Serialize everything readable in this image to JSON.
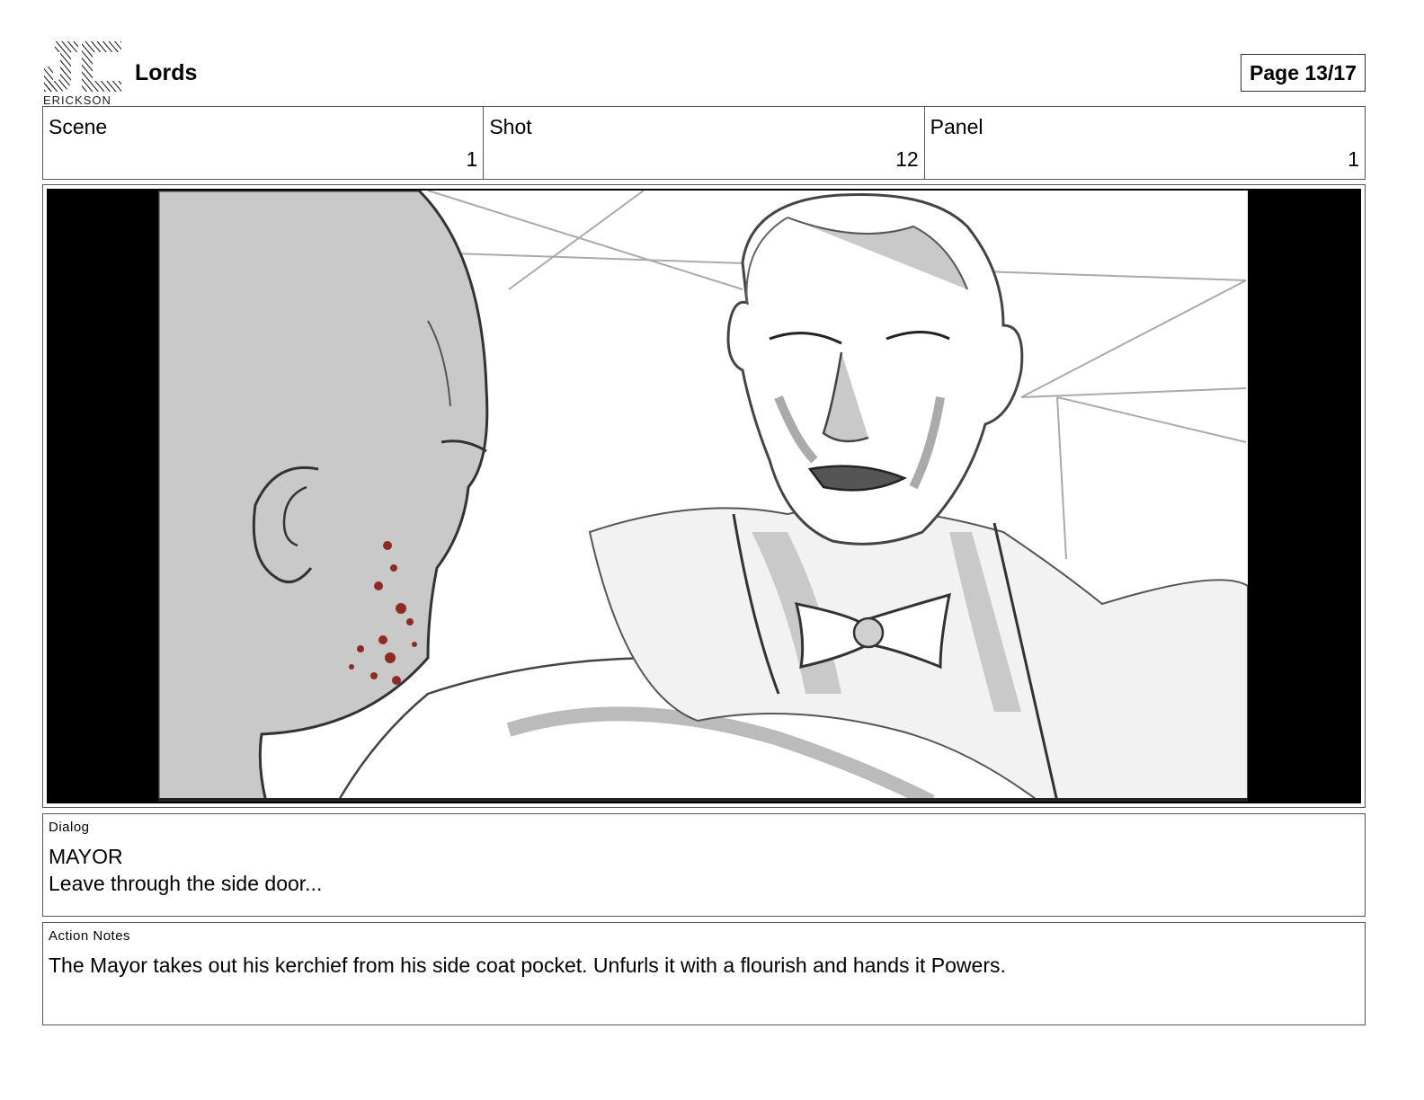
{
  "header": {
    "logo_text": "ERICKSON",
    "title": "Lords",
    "page_indicator": "Page 13/17"
  },
  "meta": {
    "scene_label": "Scene",
    "scene_value": "1",
    "shot_label": "Shot",
    "shot_value": "12",
    "panel_label": "Panel",
    "panel_value": "1"
  },
  "dialog": {
    "label": "Dialog",
    "speaker": "MAYOR",
    "line": "Leave through the side door..."
  },
  "action_notes": {
    "label": "Action Notes",
    "text": "The Mayor takes out his kerchief from his side coat pocket. Unfurls it with a flourish and hands it Powers."
  },
  "colors": {
    "sketch_gray": "#c9c9c9",
    "line": "#333333",
    "blood": "#8e2a22"
  }
}
